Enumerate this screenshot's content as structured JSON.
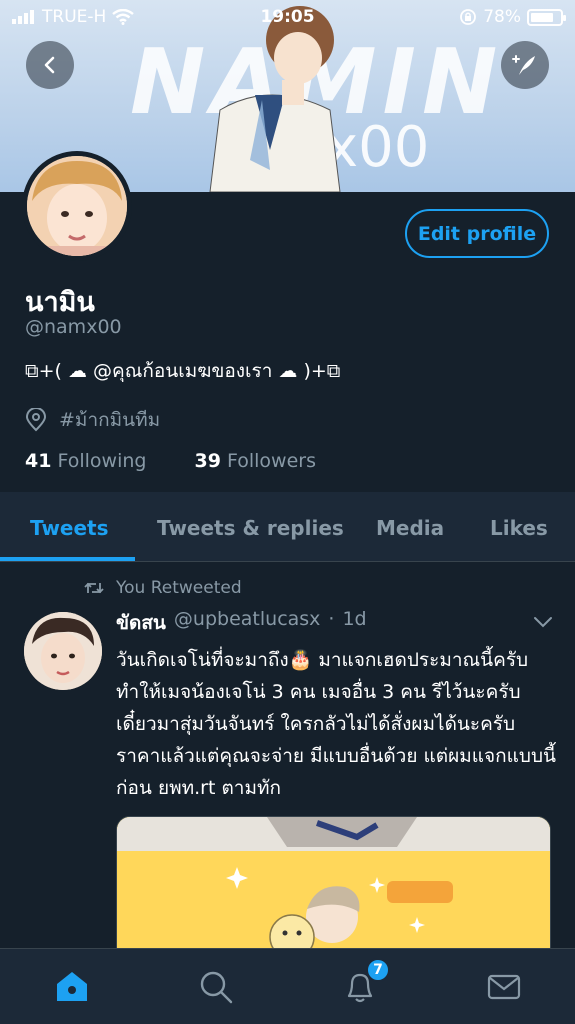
{
  "status_bar": {
    "carrier": "TRUE-H",
    "time": "19:05",
    "battery": "78%",
    "battery_level": 0.78
  },
  "banner": {
    "text": "NAMIN",
    "sub_text": "x00"
  },
  "profile": {
    "edit_button": "Edit profile",
    "display_name": "นามิน",
    "handle": "@namx00",
    "bio": "⧉+( ☁ @คุณก้อนเมฆของเรา ☁ )+⧉",
    "location": "#ม้ากมินทีม",
    "following_count": "41",
    "following_label": "Following",
    "followers_count": "39",
    "followers_label": "Followers"
  },
  "tabs": [
    {
      "label": "Tweets",
      "active": true
    },
    {
      "label": "Tweets & replies",
      "active": false
    },
    {
      "label": "Media",
      "active": false
    },
    {
      "label": "Likes",
      "active": false
    }
  ],
  "tweet": {
    "retweet_label": "You Retweeted",
    "author_name": "ขัดสน",
    "author_handle": "@upbeatlucasx",
    "separator": "·",
    "time": "1d",
    "body": "วันเกิดเจโน่ที่จะมาถึง🎂 มาแจกเฮดประมาณนี้ครับ ทำให้เมจน้องเจโน่ 3 คน เมจอื่น 3 คน รีไว้นะครับ เดี๋ยวมาสุ่มวันจันทร์ ใครกลัวไม่ได้สั่งผมได้นะครับ ราคาแล้วแต่คุณจะจ่าย มีแบบอื่นด้วย แต่ผมแจกแบบนี้ก่อน ยพท.rt ตามทัก"
  },
  "bottom_nav": {
    "notifications_badge": "7"
  },
  "colors": {
    "background": "#15202b",
    "accent": "#1da1f2",
    "secondary_text": "#8899a6"
  }
}
